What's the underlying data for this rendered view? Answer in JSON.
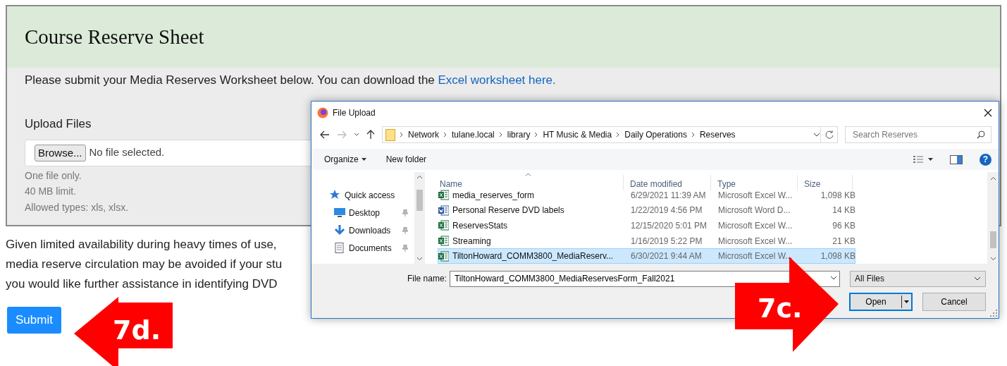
{
  "page": {
    "title": "Course Reserve Sheet",
    "intro": {
      "text": "Please submit your Media Reserves Worksheet below. You can download the",
      "link": "Excel worksheet here."
    },
    "upload": {
      "label": "Upload Files",
      "browse_button": "Browse...",
      "status": "No file selected.",
      "help": [
        "One file only.",
        "40 MB limit.",
        "Allowed types: xls, xlsx."
      ]
    },
    "paragraph_lines": [
      "Given limited availability during heavy times of use,",
      "media reserve circulation may be avoided if your stu",
      "you would like further assistance in identifying DVD"
    ],
    "submit": "Submit"
  },
  "dialog": {
    "title": "File Upload",
    "path": [
      "Network",
      "tulane.local",
      "library",
      "HT Music & Media",
      "Daily Operations",
      "Reserves"
    ],
    "search": {
      "placeholder": "Search Reserves"
    },
    "toolbar": {
      "organize": "Organize",
      "new_folder": "New folder",
      "help": "?"
    },
    "nav": [
      {
        "label": "Quick access",
        "kind": "star",
        "pinned": false
      },
      {
        "label": "Desktop",
        "kind": "desktop",
        "pinned": true
      },
      {
        "label": "Downloads",
        "kind": "download",
        "pinned": true
      },
      {
        "label": "Documents",
        "kind": "document",
        "pinned": true
      }
    ],
    "columns": [
      "Name",
      "Date modified",
      "Type",
      "Size"
    ],
    "rows": [
      {
        "name": "media_reserves_form",
        "date": "6/29/2021 11:39 AM",
        "type": "Microsoft Excel W...",
        "size": "1,098 KB",
        "kind": "excel",
        "selected": false
      },
      {
        "name": "Personal Reserve DVD labels",
        "date": "1/22/2019 4:56 PM",
        "type": "Microsoft Word D...",
        "size": "14 KB",
        "kind": "word",
        "selected": false
      },
      {
        "name": "ReservesStats",
        "date": "12/15/2020 5:01 PM",
        "type": "Microsoft Excel W...",
        "size": "96 KB",
        "kind": "excel",
        "selected": false
      },
      {
        "name": "Streaming",
        "date": "1/16/2019 5:22 PM",
        "type": "Microsoft Excel W...",
        "size": "21 KB",
        "kind": "excel",
        "selected": false
      },
      {
        "name": "TiltonHoward_COMM3800_MediaReserv...",
        "date": "6/30/2021 9:44 AM",
        "type": "Microsoft Excel W...",
        "size": "1,098 KB",
        "kind": "excel",
        "selected": true
      }
    ],
    "file_name_label": "File name:",
    "file_name": "TiltonHoward_COMM3800_MediaReservesForm_Fall2021",
    "file_type": "All Files",
    "open_button": "Open",
    "cancel_button": "Cancel"
  },
  "annotations": [
    {
      "label": "7c.",
      "kind": "right"
    },
    {
      "label": "7d.",
      "kind": "left"
    }
  ]
}
